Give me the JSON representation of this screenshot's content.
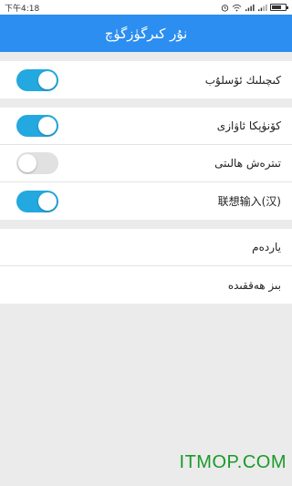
{
  "status_bar": {
    "time": "下午4:18",
    "icons": [
      "alarm-icon",
      "wifi-icon",
      "signal-icon",
      "signal-icon",
      "battery-icon"
    ]
  },
  "app_bar": {
    "title": "نۇر كىرگۈزگۈچ"
  },
  "settings": {
    "group1": [
      {
        "label": "كىچىلىك ئۆسلۇب",
        "toggle": true
      }
    ],
    "group2": [
      {
        "label": "كۆنۈپكا ئاۋازى",
        "toggle": true
      },
      {
        "label": "تىترەش ھالىتى",
        "toggle": false
      },
      {
        "label": "联想输入(汉)",
        "toggle": true
      }
    ],
    "group3": [
      {
        "label": "ياردەم"
      },
      {
        "label": "بىز ھەققىدە"
      }
    ]
  },
  "watermark": "ITMOP.COM",
  "colors": {
    "app_bar": "#2b8ef0",
    "toggle_on": "#23a8e0",
    "toggle_off": "#e1e1e1",
    "watermark": "#1a9a2a"
  }
}
